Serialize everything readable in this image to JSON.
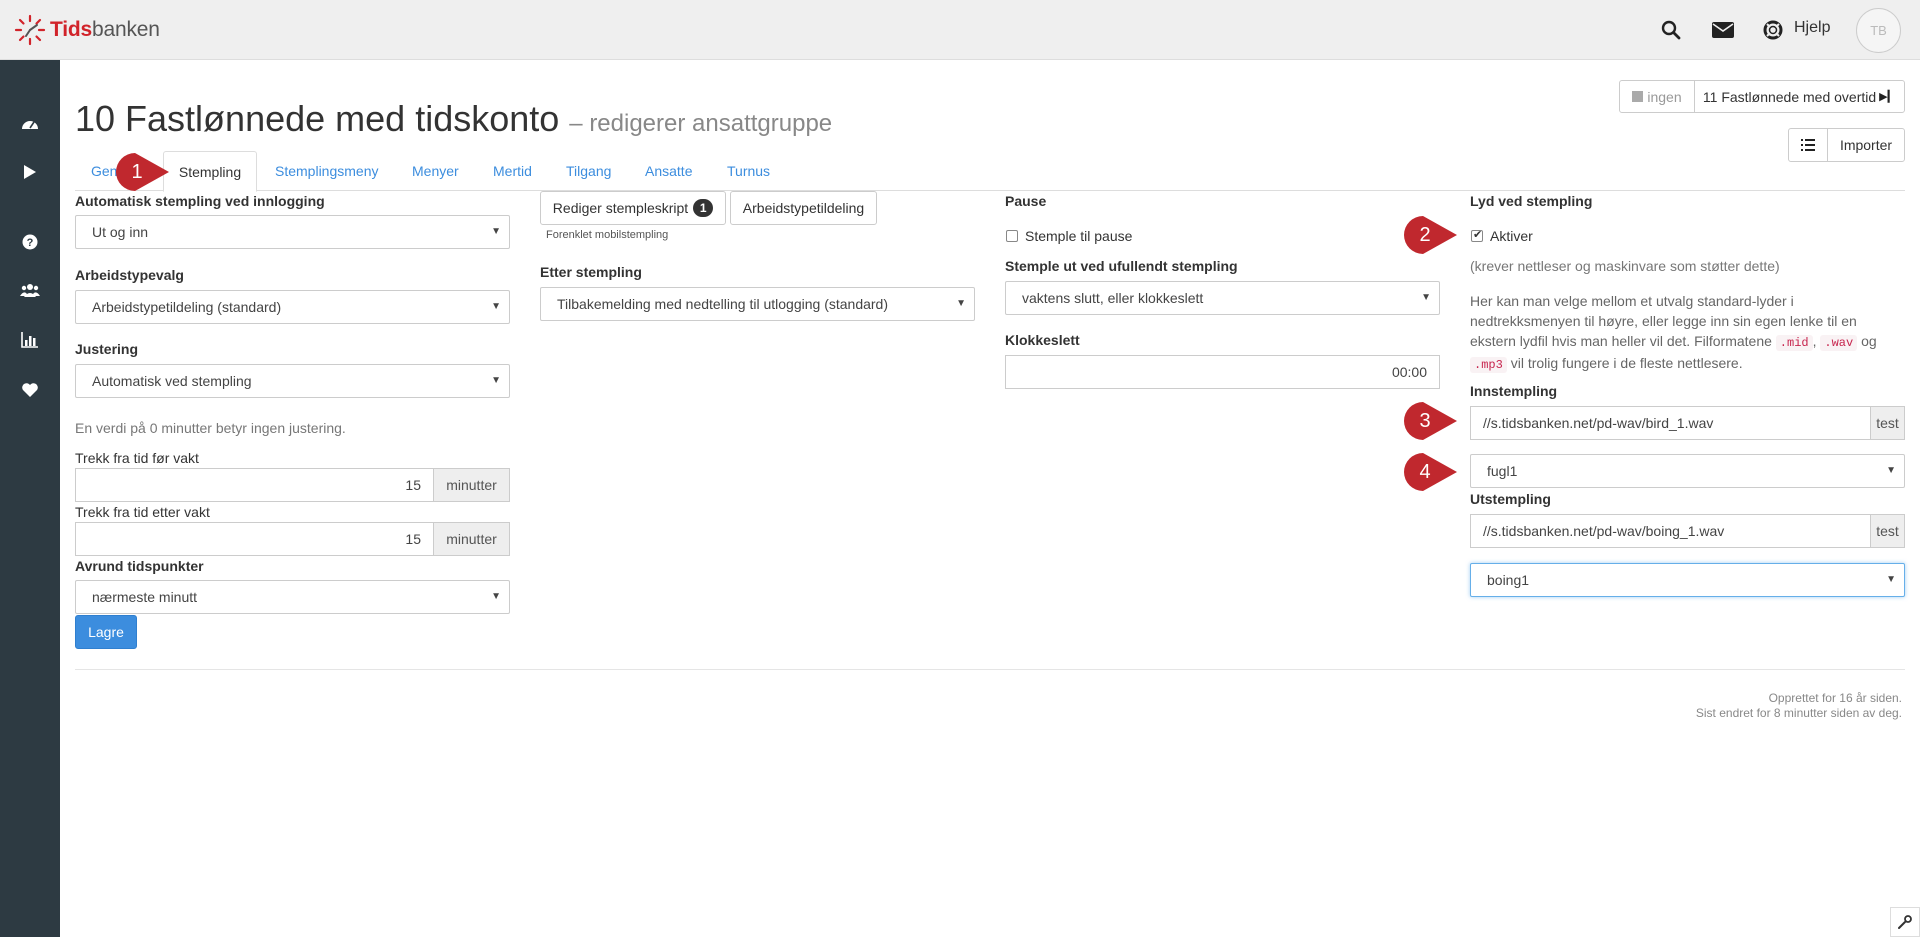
{
  "brand": {
    "part1": "Tids",
    "part2": "banken",
    "accent": "#d1232a"
  },
  "header": {
    "help_label": "Hjelp",
    "avatar_initials": "TB"
  },
  "page": {
    "title": "10 Fastlønnede med tidskonto",
    "subtitle": "– redigerer ansattgruppe"
  },
  "nav": {
    "prev_label": "ingen",
    "next_label": "11 Fastlønnede med overtid",
    "import_label": "Importer"
  },
  "tabs": [
    {
      "label": "Generelt"
    },
    {
      "label": "Stempling"
    },
    {
      "label": "Stemplingsmeny"
    },
    {
      "label": "Menyer"
    },
    {
      "label": "Mertid"
    },
    {
      "label": "Tilgang"
    },
    {
      "label": "Ansatte"
    },
    {
      "label": "Turnus"
    }
  ],
  "col1": {
    "auto_label": "Automatisk stempling ved innlogging",
    "auto_value": "Ut og inn",
    "worktype_label": "Arbeidstypevalg",
    "worktype_value": "Arbeidstypetildeling (standard)",
    "adjust_label": "Justering",
    "adjust_value": "Automatisk ved stempling",
    "adjust_help": "En verdi på 0 minutter betyr ingen justering.",
    "before_label": "Trekk fra tid før vakt",
    "before_value": "15",
    "before_unit": "minutter",
    "after_label": "Trekk fra tid etter vakt",
    "after_value": "15",
    "after_unit": "minutter",
    "round_label": "Avrund tidspunkter",
    "round_value": "nærmeste minutt",
    "save_label": "Lagre"
  },
  "col2": {
    "edit_script_label": "Rediger stempleskript",
    "edit_script_badge": "1",
    "worktype_assign_label": "Arbeidstypetildeling",
    "simplified_note": "Forenklet mobilstempling",
    "after_label": "Etter stempling",
    "after_value": "Tilbakemelding med nedtelling til utlogging (standard)"
  },
  "col3": {
    "pause_label": "Pause",
    "pause_checkbox_label": "Stemple til pause",
    "incomplete_label": "Stemple ut ved ufullendt stempling",
    "incomplete_value": "vaktens slutt, eller klokkeslett",
    "clock_label": "Klokkeslett",
    "clock_value": "00:00"
  },
  "col4": {
    "sound_label": "Lyd ved stempling",
    "activate_label": "Aktiver",
    "requires_note": "(krever nettleser og maskinvare som støtter dette)",
    "help_text_1": "Her kan man velge mellom et utvalg standard-lyder i nedtrekksmenyen til høyre, eller legge inn sin egen lenke til en ekstern lydfil hvis man heller vil det. Filformatene",
    "code_mid": ".mid",
    "sep_comma": ",",
    "code_wav": ".wav",
    "sep_og": "og",
    "code_mp3": ".mp3",
    "help_text_2": "vil trolig fungere i de fleste nettlesere.",
    "in_label": "Innstempling",
    "in_url": "//s.tidsbanken.net/pd-wav/bird_1.wav",
    "in_test": "test",
    "in_sound": "fugl1",
    "out_label": "Utstempling",
    "out_url": "//s.tidsbanken.net/pd-wav/boing_1.wav",
    "out_test": "test",
    "out_sound": "boing1"
  },
  "markers": [
    "1",
    "2",
    "3",
    "4"
  ],
  "marker_color": "#c0282e",
  "footer": {
    "created": "Opprettet for 16 år siden.",
    "changed": "Sist endret for 8 minutter siden av deg."
  }
}
